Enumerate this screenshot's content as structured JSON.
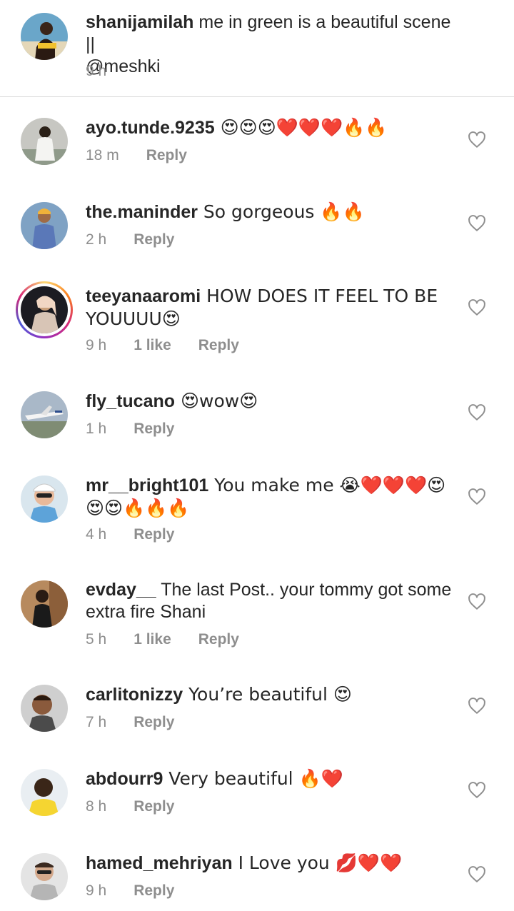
{
  "caption": {
    "username": "shanijamilah",
    "text_line1": " me in green is a beautiful scene ||",
    "text_line2": "@meshki",
    "time": "9 h"
  },
  "comments": [
    {
      "username": "ayo.tunde.9235",
      "text": " 😍😍😍❤️❤️❤️🔥🔥",
      "time": "18 m",
      "likes": "",
      "reply": "Reply"
    },
    {
      "username": "the.maninder",
      "text": " So gorgeous 🔥🔥",
      "time": "2 h",
      "likes": "",
      "reply": "Reply"
    },
    {
      "username": "teeyanaaromi",
      "text": " HOW DOES IT FEEL TO BE YOUUUU😍",
      "time": "9 h",
      "likes": "1 like",
      "reply": "Reply"
    },
    {
      "username": "fly_tucano",
      "text": " 😍wow😍",
      "time": "1 h",
      "likes": "",
      "reply": "Reply"
    },
    {
      "username": "mr__bright101",
      "text": " You make me 😭❤️❤️❤️😍😍😍🔥🔥🔥",
      "time": "4 h",
      "likes": "",
      "reply": "Reply"
    },
    {
      "username": "evday__",
      "text": " The last Post.. your tommy got some extra fire Shani",
      "time": "5 h",
      "likes": "1 like",
      "reply": "Reply"
    },
    {
      "username": "carlitonizzy",
      "text": " You’re beautiful 😍",
      "time": "7 h",
      "likes": "",
      "reply": "Reply"
    },
    {
      "username": "abdourr9",
      "text": " Very beautiful 🔥❤️",
      "time": "8 h",
      "likes": "",
      "reply": "Reply"
    },
    {
      "username": "hamed_mehriyan",
      "text": " I Love you 💋❤️❤️",
      "time": "9 h",
      "likes": "",
      "reply": "Reply"
    }
  ],
  "icons": {
    "heart": "heart-outline-icon"
  },
  "colors": {
    "text": "#262626",
    "secondary": "#8e8e8e",
    "divider": "#dbdbdb"
  }
}
